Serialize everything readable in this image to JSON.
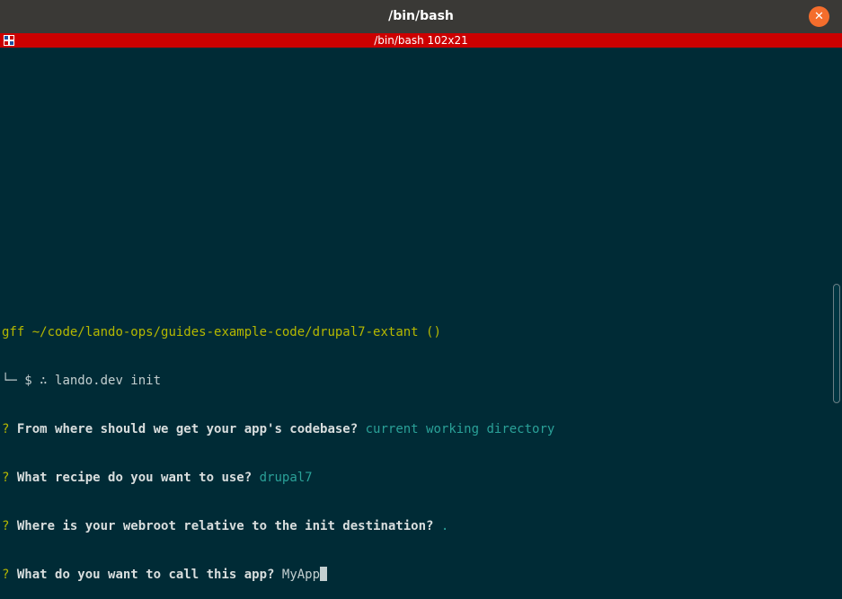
{
  "window": {
    "title": "/bin/bash",
    "close_glyph": "✕"
  },
  "tab": {
    "label": "/bin/bash 102x21"
  },
  "terminal": {
    "prompt": {
      "user": "gff",
      "path": "~/code/lando-ops/guides-example-code/drupal7-extant",
      "branch": "()",
      "prefix": "└─ $ ∴",
      "command": "lando.dev init"
    },
    "questions": [
      {
        "marker": "?",
        "question": "From where should we get your app's codebase?",
        "answer": "current working directory"
      },
      {
        "marker": "?",
        "question": "What recipe do you want to use?",
        "answer": "drupal7"
      },
      {
        "marker": "?",
        "question": "Where is your webroot relative to the init destination?",
        "answer": "."
      },
      {
        "marker": "?",
        "question": "What do you want to call this app?",
        "answer": "MyApp"
      }
    ]
  },
  "colors": {
    "background": "#002b36",
    "titlebar": "#3a3936",
    "tabbar": "#cc0000",
    "close_button": "#f46d2c",
    "prompt_yellow": "#b5b800",
    "answer_teal": "#2aa198"
  },
  "icons": {
    "close": "close-icon",
    "tab": "terminal-tab-icon"
  }
}
